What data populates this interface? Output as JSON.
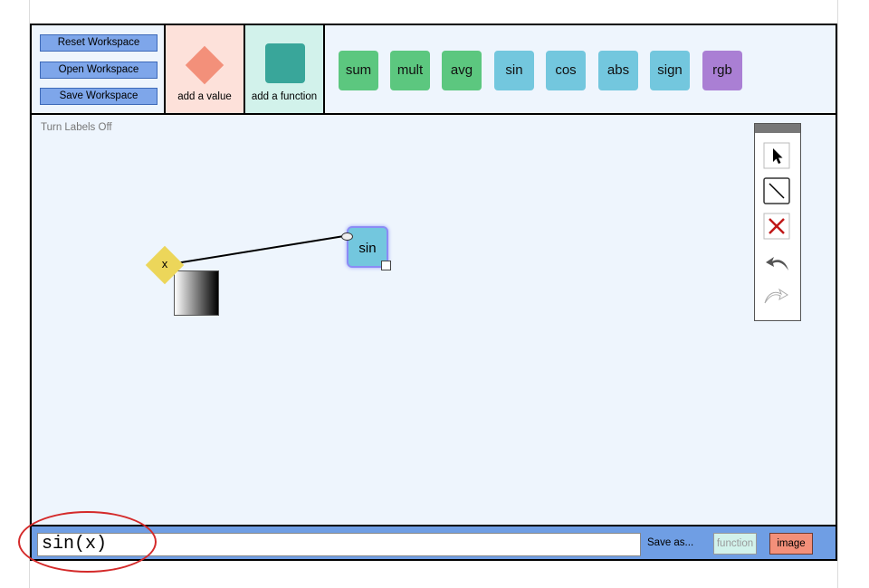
{
  "workspace": {
    "reset_label": "Reset Workspace",
    "open_label": "Open Workspace",
    "save_label": "Save Workspace"
  },
  "add_value": {
    "label": "add a value",
    "color": "#f3907a",
    "bg": "#fde1da"
  },
  "add_function": {
    "label": "add a function",
    "color": "#39a69a",
    "bg": "#d2f2eb"
  },
  "functions": [
    {
      "label": "sum",
      "color": "#5cc77f"
    },
    {
      "label": "mult",
      "color": "#5cc77f"
    },
    {
      "label": "avg",
      "color": "#5cc77f"
    },
    {
      "label": "sin",
      "color": "#73c7de"
    },
    {
      "label": "cos",
      "color": "#73c7de"
    },
    {
      "label": "abs",
      "color": "#73c7de"
    },
    {
      "label": "sign",
      "color": "#73c7de"
    },
    {
      "label": "rgb",
      "color": "#aa7fd4"
    }
  ],
  "canvas": {
    "labels_toggle": "Turn Labels Off",
    "nodes": {
      "value": {
        "label": "x",
        "color": "#ecd65a"
      },
      "function": {
        "label": "sin",
        "color": "#73c7de"
      }
    }
  },
  "tools": [
    "pointer-tool",
    "line-tool",
    "delete-tool",
    "undo-tool",
    "redo-tool"
  ],
  "bottom": {
    "expression": "sin(x)",
    "save_as_label": "Save as...",
    "function_label": "function",
    "image_label": "image"
  },
  "annotation_color": "#d42a2a"
}
